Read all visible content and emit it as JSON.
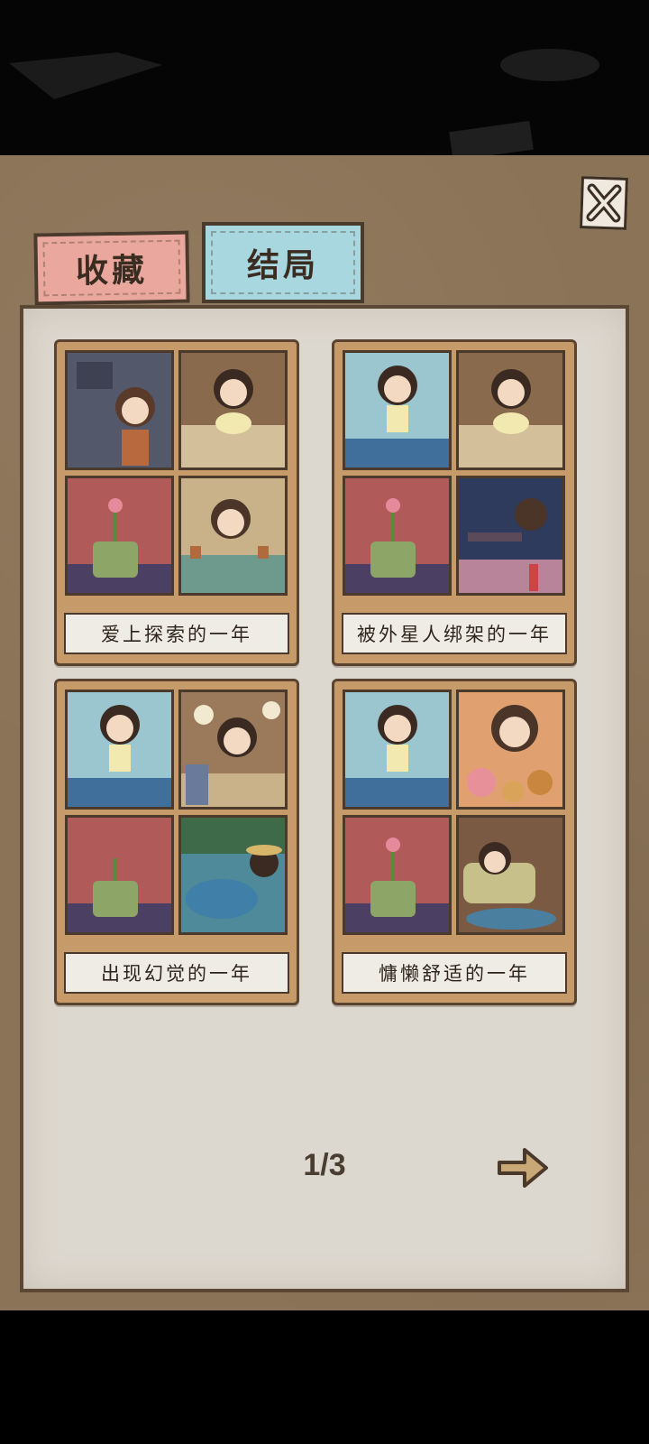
{
  "tabs": {
    "favorites": "收藏",
    "endings": "结局"
  },
  "endings": [
    {
      "title": "爱上探索的一年"
    },
    {
      "title": "被外星人绑架的一年"
    },
    {
      "title": "出现幻觉的一年"
    },
    {
      "title": "慵懒舒适的一年"
    }
  ],
  "pagination": {
    "label": "1/3",
    "current": 1,
    "total": 3
  },
  "colors": {
    "board": "#8b7357",
    "panel": "#ddd8cf",
    "card": "#c79a69",
    "tab_favorites": "#eaa79e",
    "tab_endings": "#a8d7e0"
  },
  "icons": {
    "close": "close-x-icon",
    "next": "arrow-right-icon"
  }
}
